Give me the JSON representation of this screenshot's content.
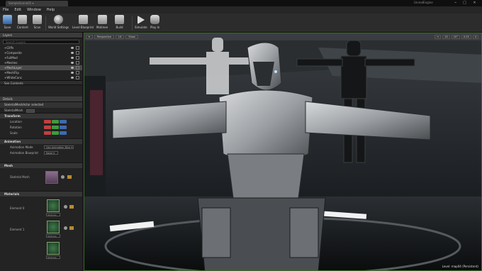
{
  "window": {
    "tab_title": "SampleScene01 ▾",
    "app_name": "UnrealEngine",
    "controls": [
      "─",
      "□",
      "✕"
    ]
  },
  "menu": [
    "File",
    "Edit",
    "Window",
    "Help"
  ],
  "toolbar": [
    {
      "label": "Save",
      "icon": "save-icon"
    },
    {
      "label": "Content",
      "icon": "content-icon"
    },
    {
      "label": "Scan",
      "icon": "scan-icon"
    },
    {
      "label": "World Settings",
      "icon": "world-settings-icon"
    },
    {
      "label": "Level Blueprint",
      "icon": "level-blueprint-icon"
    },
    {
      "label": "Matinee",
      "icon": "matinee-icon"
    },
    {
      "label": "Build",
      "icon": "build-icon"
    },
    {
      "label": "Simulate",
      "icon": "simulate-icon"
    },
    {
      "label": "Play In",
      "icon": "play-icon"
    }
  ],
  "layers": {
    "title": "Layers",
    "search_placeholder": "Search Layers",
    "items": [
      "+Cliffs",
      "+Composite",
      "+FullMod",
      "+Meshes",
      "+MeshLayer",
      "+MeshFlip",
      "+WhiteConc"
    ],
    "selected_index": 4,
    "see_contents": "See Contents"
  },
  "details": {
    "title": "Details",
    "selected_actor": "SkeletalMeshActor selected",
    "component": "SkeletalMesh",
    "sections": {
      "transform": "Transform",
      "animation": "Animation",
      "mesh": "Mesh",
      "materials": "Materials"
    },
    "transform_rows": [
      "Location",
      "Rotation",
      "Scale"
    ],
    "animation_mode_label": "Animation Mode",
    "animation_mode_value": "Use Animation Blue ▾",
    "animation_blueprint_label": "Animation Blueprint",
    "animation_blueprint_value": "None ▾",
    "skeletal_mesh_label": "Skeletal Mesh",
    "elements": [
      "Element 0",
      "Element 1"
    ],
    "material_names": [
      "Textures",
      "Textures",
      "Textures"
    ]
  },
  "viewport": {
    "buttons": [
      "Perspective",
      "Lit",
      "Show"
    ],
    "right_buttons": [
      "↔",
      "10",
      "10°",
      "0.25",
      "4"
    ],
    "level_text": "Level: map04 (Persistent)"
  },
  "colors": {
    "x_axis": "#c04040",
    "y_axis": "#3f9a3f",
    "z_axis": "#3f6ab0",
    "accent": "#3a6a2a"
  }
}
